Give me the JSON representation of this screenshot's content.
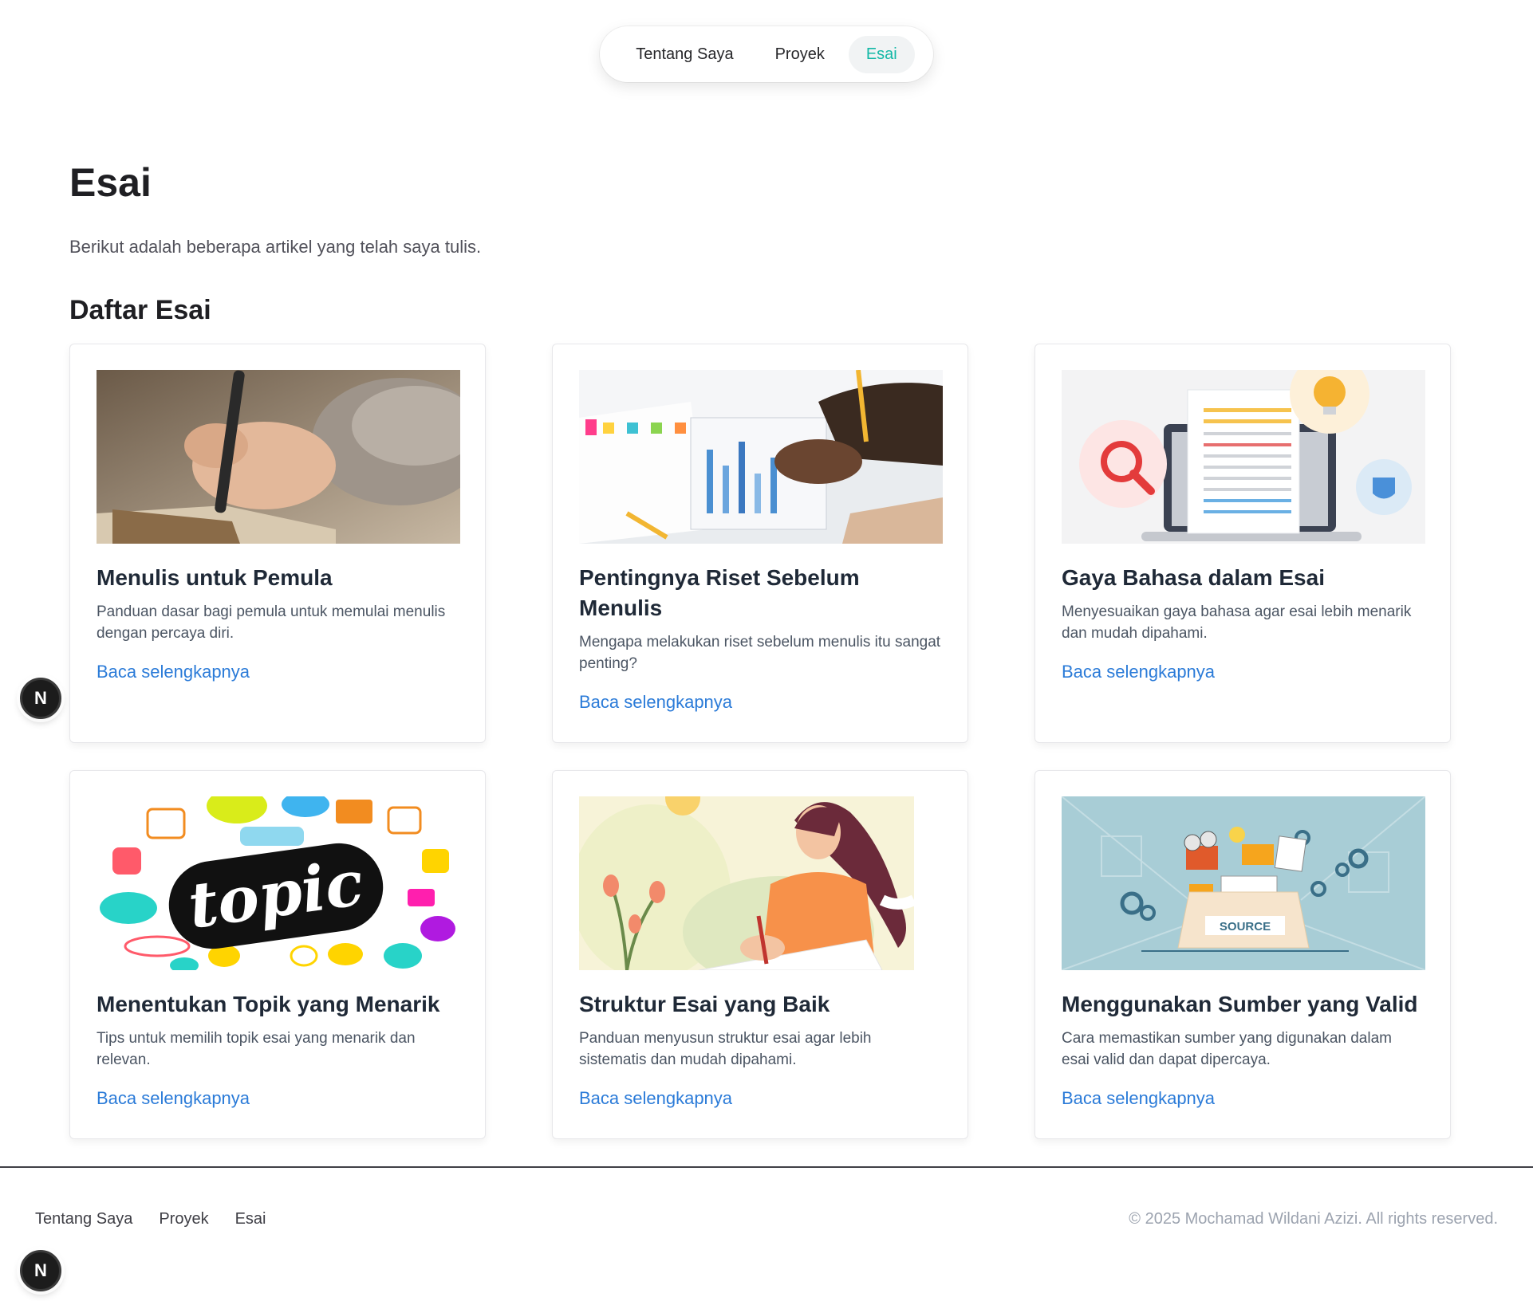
{
  "nav": {
    "items": [
      {
        "label": "Tentang Saya",
        "active": false
      },
      {
        "label": "Proyek",
        "active": false
      },
      {
        "label": "Esai",
        "active": true
      }
    ],
    "active_color": "#14b8a6"
  },
  "page": {
    "title": "Esai",
    "intro": "Berikut adalah beberapa artikel yang telah saya tulis.",
    "section_title": "Daftar Esai"
  },
  "cards": [
    {
      "title": "Menulis untuk Pemula",
      "desc": "Panduan dasar bagi pemula untuk memulai menulis dengan percaya diri.",
      "link": "Baca selengkapnya",
      "image": "hand-writing-notebook"
    },
    {
      "title": "Pentingnya Riset Sebelum Menulis",
      "desc": "Mengapa melakukan riset sebelum menulis itu sangat penting?",
      "link": "Baca selengkapnya",
      "image": "research-charts-desk"
    },
    {
      "title": "Gaya Bahasa dalam Esai",
      "desc": "Menyesuaikan gaya bahasa agar esai lebih menarik dan mudah dipahami.",
      "link": "Baca selengkapnya",
      "image": "laptop-document-illustration"
    },
    {
      "title": "Menentukan Topik yang Menarik",
      "desc": "Tips untuk memilih topik esai yang menarik dan relevan.",
      "link": "Baca selengkapnya",
      "image": "topic-speech-bubbles"
    },
    {
      "title": "Struktur Esai yang Baik",
      "desc": "Panduan menyusun struktur esai agar lebih sistematis dan mudah dipahami.",
      "link": "Baca selengkapnya",
      "image": "woman-writing-illustration"
    },
    {
      "title": "Menggunakan Sumber yang Valid",
      "desc": "Cara memastikan sumber yang digunakan dalam esai valid dan dapat dipercaya.",
      "link": "Baca selengkapnya",
      "image": "source-box-illustration"
    }
  ],
  "images": {
    "topic_word": "topic",
    "source_label": "SOURCE"
  },
  "badge": {
    "letter": "N"
  },
  "footer": {
    "links": [
      "Tentang Saya",
      "Proyek",
      "Esai"
    ],
    "copyright": "© 2025 Mochamad Wildani Azizi. All rights reserved."
  },
  "colors": {
    "link": "#2b7bd8",
    "title": "#1f2937",
    "muted": "#9ca3af"
  }
}
